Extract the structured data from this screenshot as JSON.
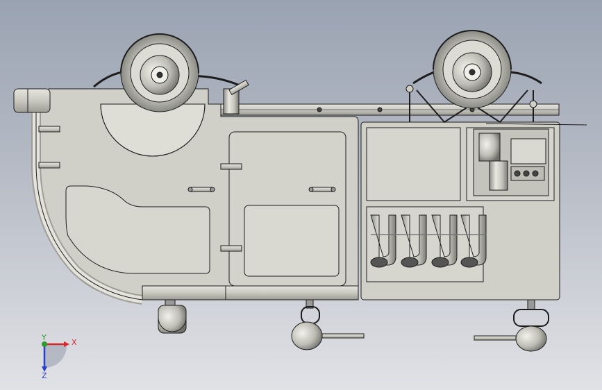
{
  "axis_triad": {
    "x_label": "X",
    "y_label": "Y",
    "z_label": "Z",
    "x_color": "#d8262a",
    "y_color": "#2f9a2f",
    "z_color": "#2a3fc9"
  },
  "colors": {
    "background_top": "#9aa3b2",
    "background_bottom": "#e1e2e6",
    "body_fill": "#cfcfc8",
    "line": "#1c1c1c"
  }
}
